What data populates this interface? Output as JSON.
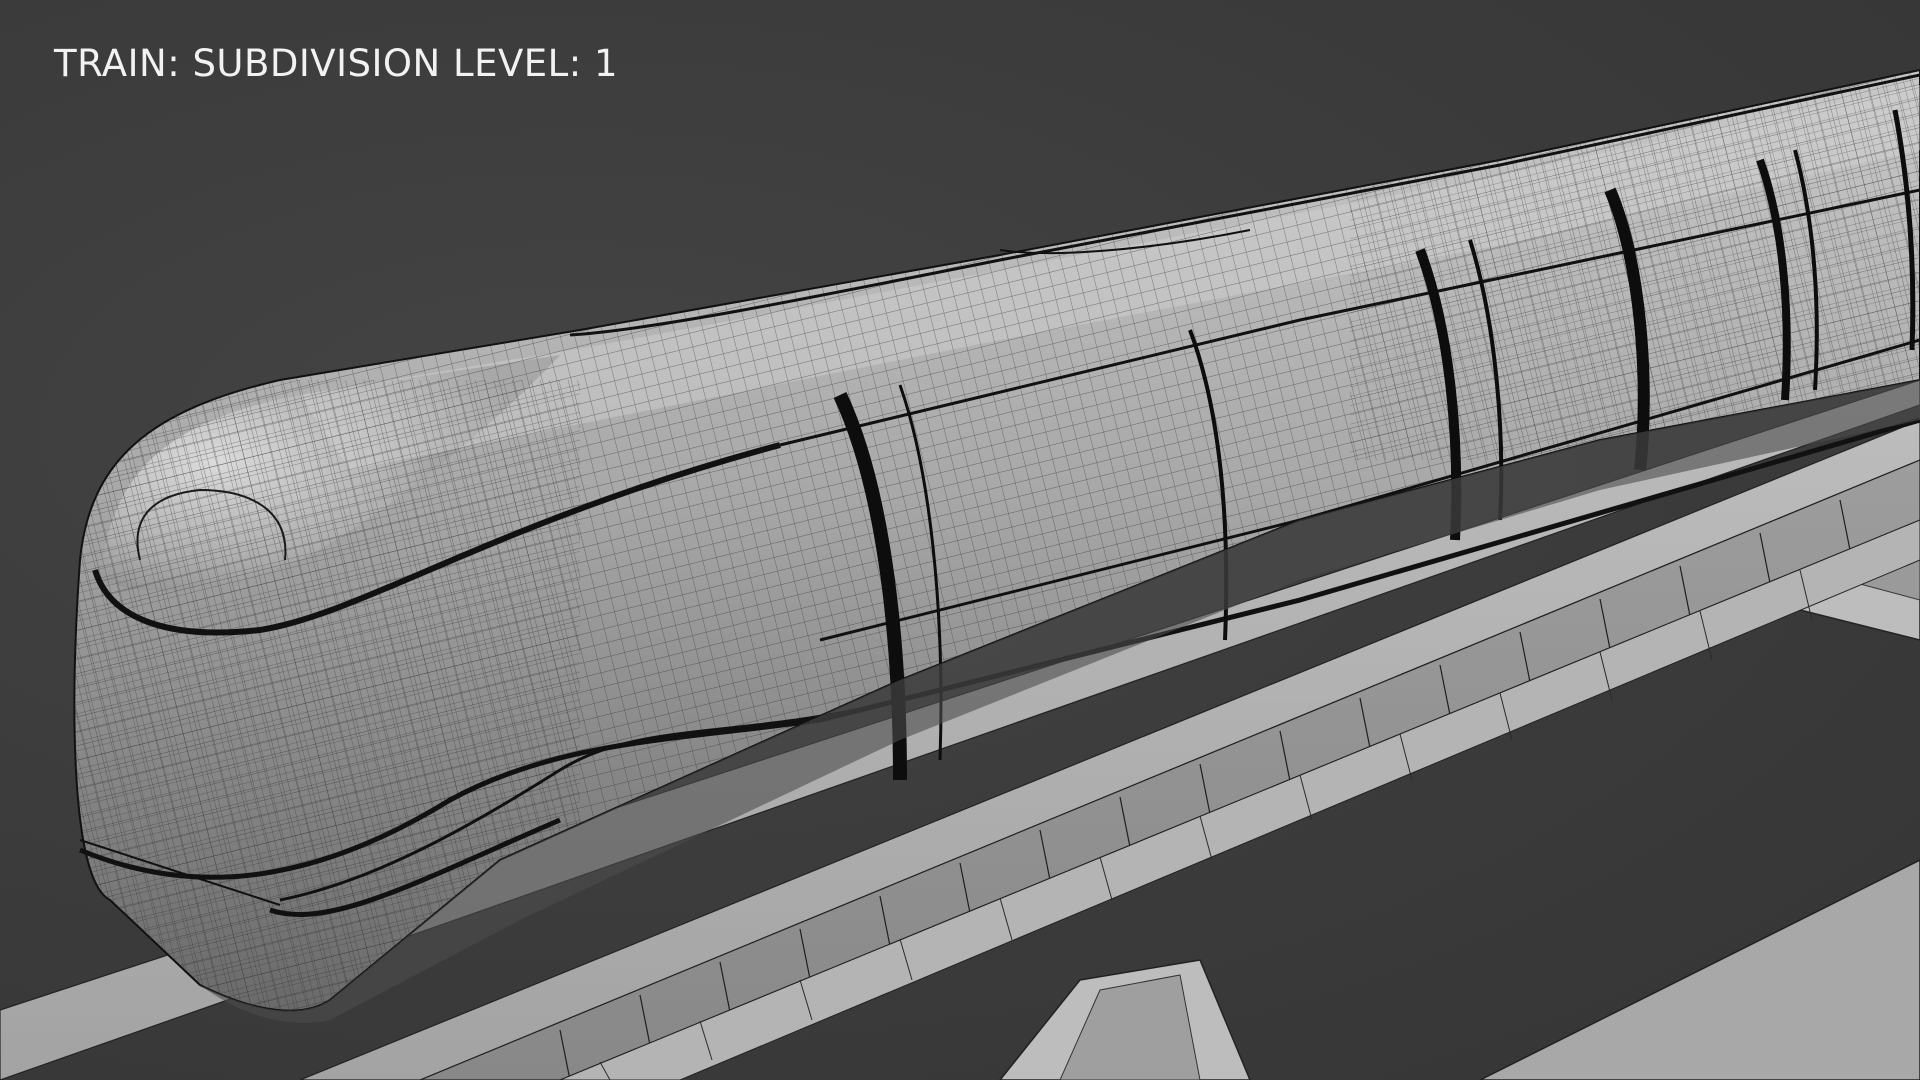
{
  "caption": "TRAIN: SUBDIVISION LEVEL: 1",
  "scene": {
    "subject": "monorail-train-wireframe",
    "background_color": "#3a3a3a",
    "surface_color": "#a9a9a9",
    "wire_color": "#1a1a1a",
    "icons": [
      "train-model",
      "monorail-beam",
      "support-pillar"
    ]
  }
}
